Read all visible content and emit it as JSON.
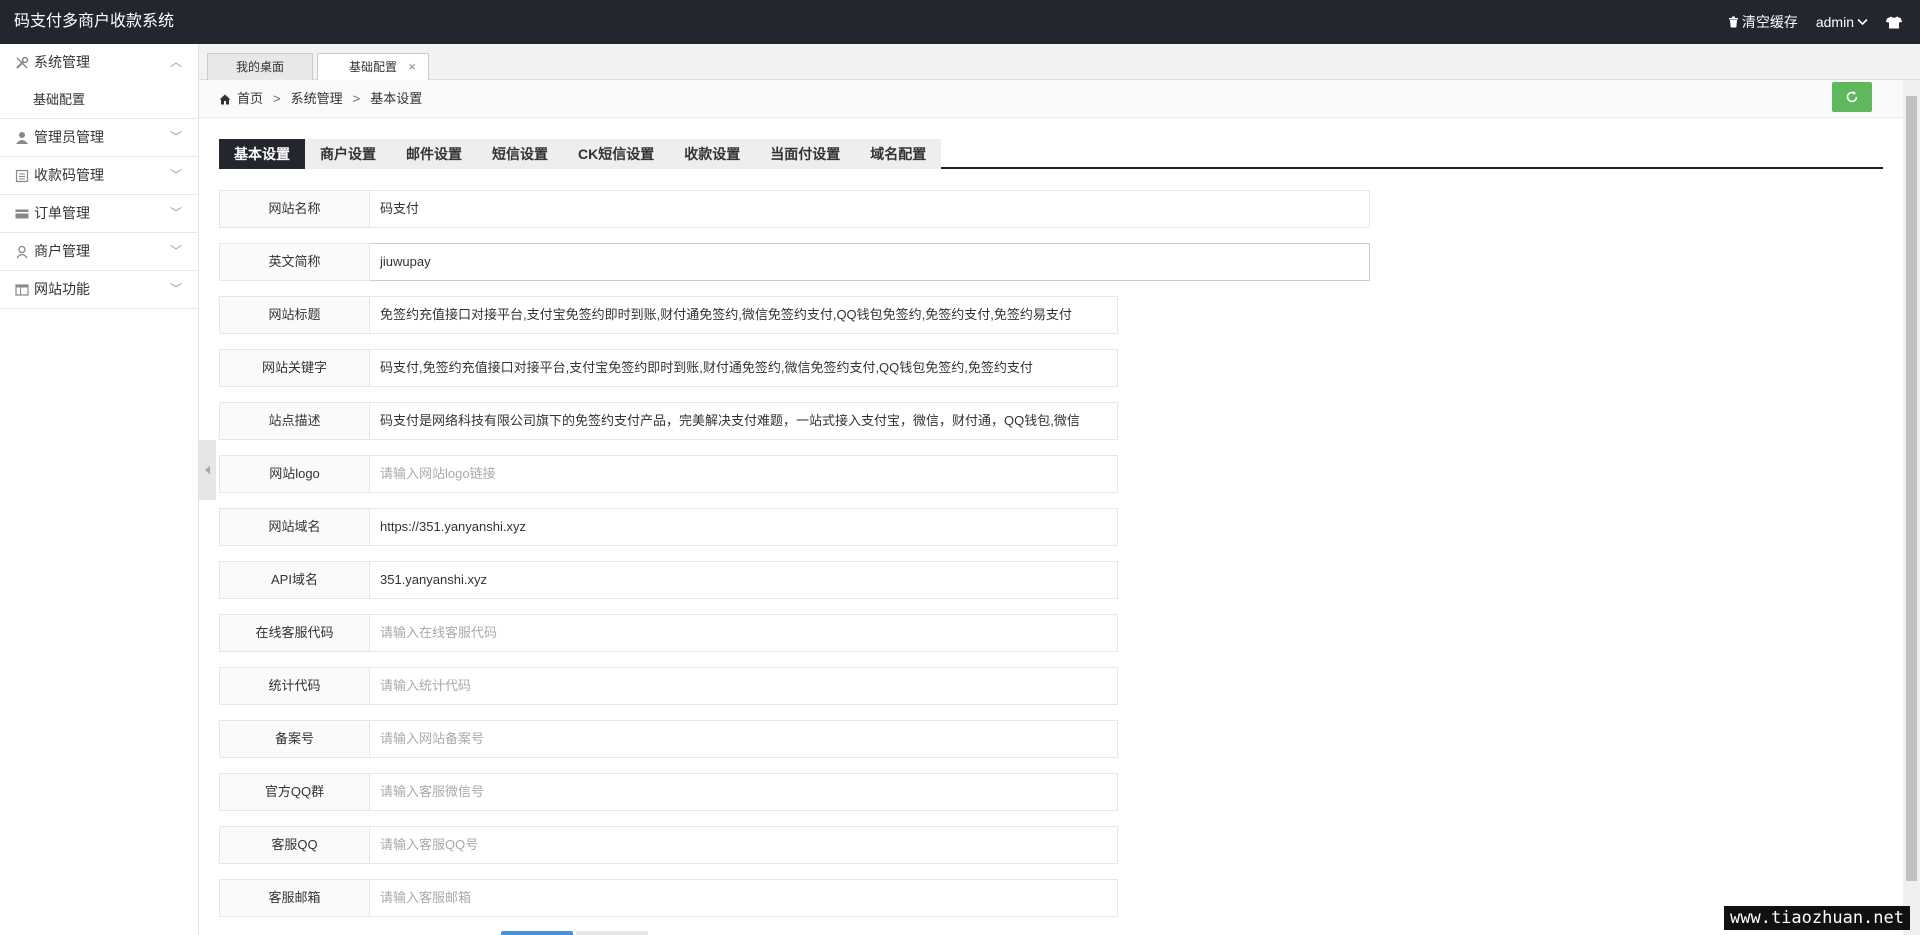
{
  "header": {
    "brand": "码支付多商户收款系统",
    "clear_cache": "清空缓存",
    "user": "admin"
  },
  "sidebar": {
    "groups": [
      {
        "label": "系统管理",
        "icon": "tools-icon",
        "expanded": true,
        "children": [
          "基础配置"
        ]
      },
      {
        "label": "管理员管理",
        "icon": "user-icon",
        "expanded": false
      },
      {
        "label": "收款码管理",
        "icon": "list-icon",
        "expanded": false
      },
      {
        "label": "订单管理",
        "icon": "card-icon",
        "expanded": false
      },
      {
        "label": "商户管理",
        "icon": "people-icon",
        "expanded": false
      },
      {
        "label": "网站功能",
        "icon": "window-icon",
        "expanded": false
      }
    ]
  },
  "tabs": {
    "t1": "我的桌面",
    "t2": "基础配置",
    "close": "×"
  },
  "breadcrumb": {
    "home": "首页",
    "level1": "系统管理",
    "level2": "基本设置",
    "sep": ">"
  },
  "content_tabs": [
    "基本设置",
    "商户设置",
    "邮件设置",
    "短信设置",
    "CK短信设置",
    "收款设置",
    "当面付设置",
    "域名配置"
  ],
  "form": {
    "site_name": {
      "label": "网站名称",
      "value": "码支付"
    },
    "en_name": {
      "label": "英文简称",
      "value": "jiuwupay"
    },
    "site_title": {
      "label": "网站标题",
      "value": "免签约充值接口对接平台,支付宝免签约即时到账,财付通免签约,微信免签约支付,QQ钱包免签约,免签约支付,免签约易支付"
    },
    "keywords": {
      "label": "网站关键字",
      "value": "码支付,免签约充值接口对接平台,支付宝免签约即时到账,财付通免签约,微信免签约支付,QQ钱包免签约,免签约支付"
    },
    "description": {
      "label": "站点描述",
      "value": "码支付是网络科技有限公司旗下的免签约支付产品，完美解决支付难题，一站式接入支付宝，微信，财付通，QQ钱包,微信"
    },
    "logo": {
      "label": "网站logo",
      "placeholder": "请输入网站logo链接"
    },
    "domain": {
      "label": "网站域名",
      "value": "https://351.yanyanshi.xyz"
    },
    "api_domain": {
      "label": "API域名",
      "value": "351.yanyanshi.xyz"
    },
    "kefu_code": {
      "label": "在线客服代码",
      "placeholder": "请输入在线客服代码"
    },
    "stats_code": {
      "label": "统计代码",
      "placeholder": "请输入统计代码"
    },
    "icp": {
      "label": "备案号",
      "placeholder": "请输入网站备案号"
    },
    "qq_group": {
      "label": "官方QQ群",
      "placeholder": "请输入客服微信号"
    },
    "kefu_qq": {
      "label": "客服QQ",
      "placeholder": "请输入客服QQ号"
    },
    "kefu_email": {
      "label": "客服邮箱",
      "placeholder": "请输入客服邮箱"
    }
  },
  "watermark": "www.tiaozhuan.net"
}
